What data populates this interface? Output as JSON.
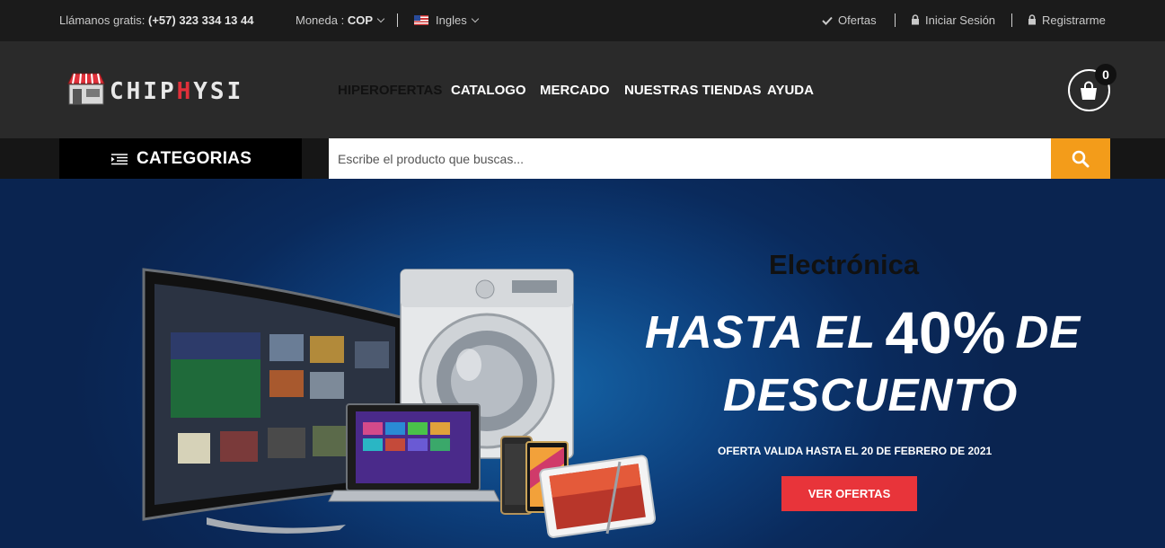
{
  "topbar": {
    "phone_label": "Llámanos gratis:",
    "phone_number": "(+57) 323 334 13 44",
    "currency_label": "Moneda :",
    "currency_value": "COP",
    "language": "Ingles",
    "links": [
      {
        "label": "Ofertas",
        "icon": "check-icon"
      },
      {
        "label": "Iniciar Sesión",
        "icon": "lock-icon"
      },
      {
        "label": "Registrarme",
        "icon": "lock-icon"
      }
    ]
  },
  "header": {
    "logo": {
      "part1": "CHIP",
      "part2": "H",
      "part3": "YSI"
    },
    "nav": [
      "HIPEROFERTAS",
      "CATALOGO",
      "MERCADO",
      "NUESTRAS TIENDAS",
      "AYUDA"
    ],
    "active_nav": "HIPEROFERTAS",
    "cart_count": "0"
  },
  "search": {
    "categories_label": "CATEGORIAS",
    "placeholder": "Escribe el producto que buscas..."
  },
  "banner": {
    "category": "Electrónica",
    "headline_start": "HASTA EL",
    "headline_percent": "40%",
    "headline_end": "DE",
    "headline_line2": "DESCUENTO",
    "note": "OFERTA VALIDA HASTA EL 20 DE FEBRERO DE 2021",
    "button_label": "VER OFERTAS"
  },
  "colors": {
    "accent_orange": "#f39c1a",
    "accent_red": "#e8343a",
    "logo_red": "#e0303a",
    "banner_blue": "#0d3f7c"
  }
}
